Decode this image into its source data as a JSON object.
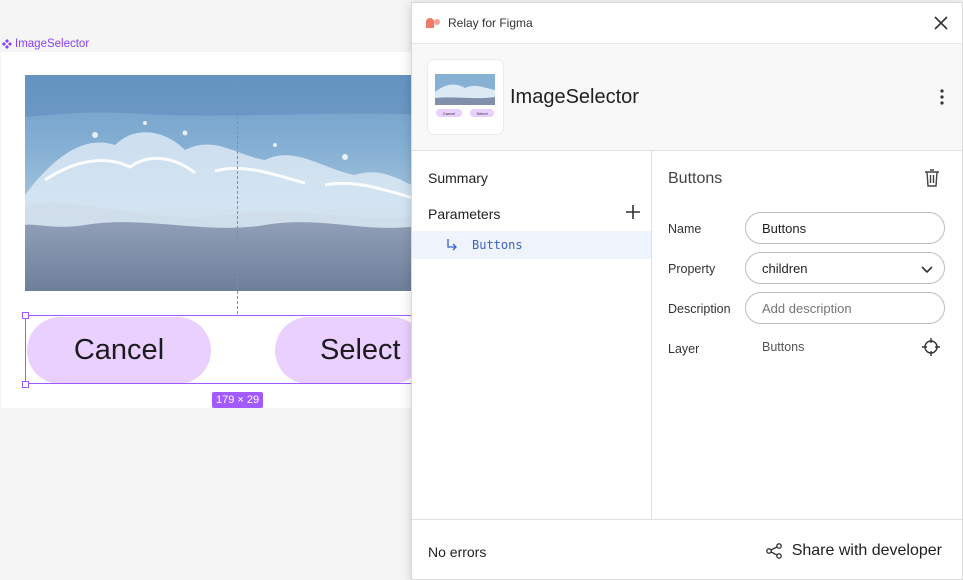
{
  "canvas": {
    "frame_label": "ImageSelector",
    "buttons": {
      "cancel": "Cancel",
      "select": "Select"
    },
    "dimension_badge": "179 × 29"
  },
  "plugin": {
    "window_title": "Relay for Figma",
    "component_name": "ImageSelector",
    "thumbnail_buttons": {
      "cancel": "Cancel",
      "select": "Select"
    },
    "sidebar": {
      "summary": "Summary",
      "parameters": "Parameters",
      "parameter_items": [
        "Buttons"
      ]
    },
    "detail": {
      "title": "Buttons",
      "name_label": "Name",
      "name_value": "Buttons",
      "property_label": "Property",
      "property_value": "children",
      "description_label": "Description",
      "description_placeholder": "Add description",
      "layer_label": "Layer",
      "layer_value": "Buttons"
    },
    "footer": {
      "status": "No errors",
      "share_label": "Share with developer"
    }
  },
  "colors": {
    "selection": "#a259ff",
    "button_fill": "#ead0ff",
    "parameter_highlight": "#eef3fc",
    "parameter_text": "#3b62c4",
    "relay_logo": "#f07a6a"
  },
  "icons": {
    "frame": "component-icon",
    "logo": "relay-logo-icon",
    "close": "close-icon",
    "more": "more-vertical-icon",
    "add": "plus-icon",
    "param": "subdirectory-arrow-icon",
    "delete": "trash-icon",
    "dropdown": "chevron-down-icon",
    "locate": "crosshair-icon",
    "share": "share-icon"
  }
}
